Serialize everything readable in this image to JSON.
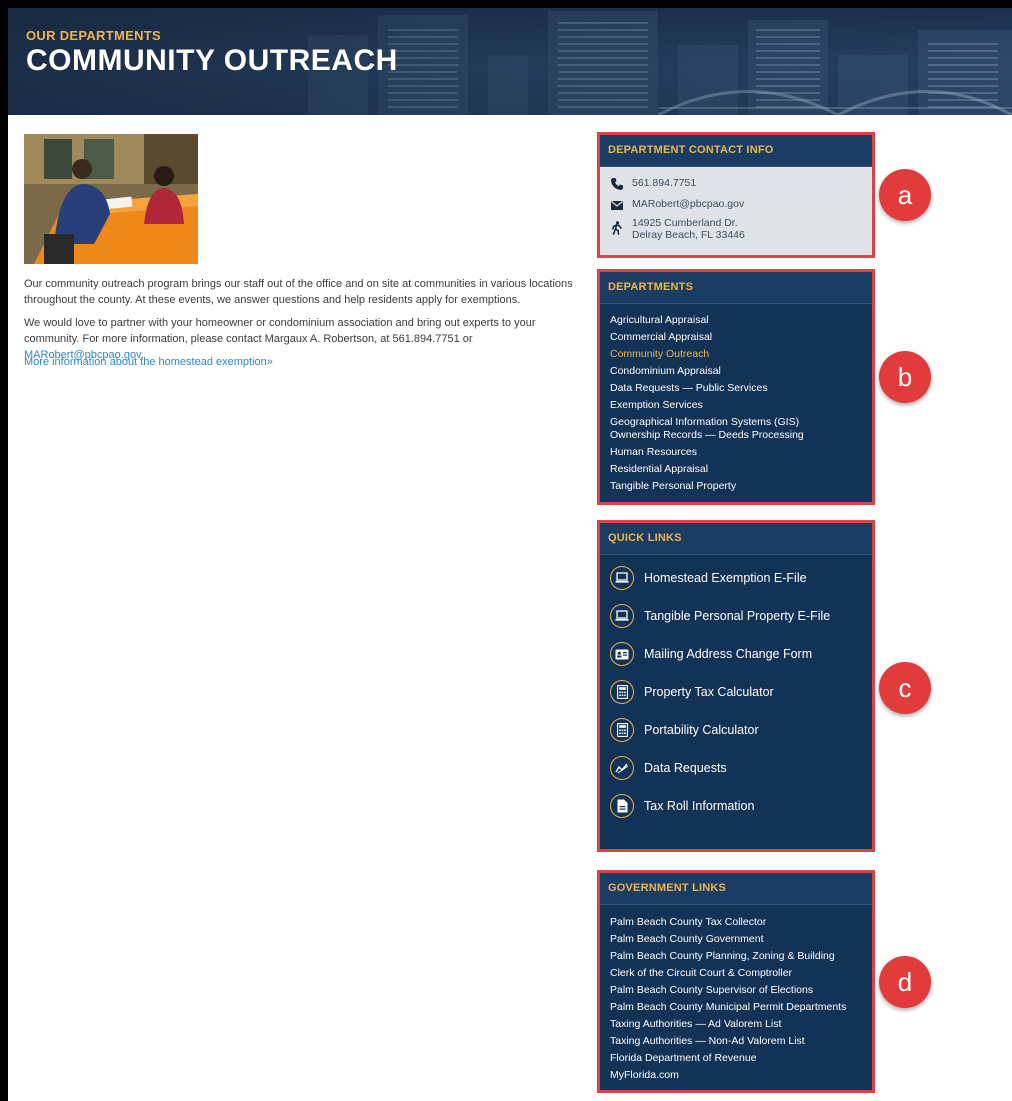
{
  "banner": {
    "eyebrow": "OUR DEPARTMENTS",
    "title": "COMMUNITY OUTREACH"
  },
  "content": {
    "photo_icon": "photo-community-outreach",
    "paragraph1": "Our community outreach program brings our staff out of the office and on site at communities in various locations throughout the county. At these events, we answer questions and help residents apply for exemptions.",
    "paragraph2_pre": "We would love to partner with your homeowner or condominium association and bring out experts to your community. For more information, please contact Margaux A. Robertson, at 561.894.7751 or ",
    "paragraph2_email": "MARobert@pbcpao.gov",
    "paragraph2_post": ".",
    "homestead_link": "More information about the homestead exemption»"
  },
  "contact": {
    "heading": "DEPARTMENT CONTACT INFO",
    "phone": "561.894.7751",
    "email": "MARobert@pbcpao.gov",
    "address_line1": "14925 Cumberland Dr.",
    "address_line2": "Delray Beach, FL 33446"
  },
  "departments": {
    "heading": "DEPARTMENTS",
    "items": [
      "Agricultural Appraisal",
      "Commercial Appraisal",
      "Community Outreach",
      "Condominium Appraisal",
      "Data Requests — Public Services",
      "Exemption Services",
      "Geographical Information Systems (GIS)",
      "Ownership Records — Deeds Processing",
      "Human Resources",
      "Residential Appraisal",
      "Tangible Personal Property"
    ]
  },
  "quick_links": {
    "heading": "QUICK LINKS",
    "items": [
      {
        "label": "Homestead Exemption E-File",
        "icon": "laptop-icon"
      },
      {
        "label": "Tangible Personal Property E-File",
        "icon": "laptop-icon"
      },
      {
        "label": "Mailing Address Change Form",
        "icon": "id-card-icon"
      },
      {
        "label": "Property Tax Calculator",
        "icon": "calculator-icon"
      },
      {
        "label": "Portability Calculator",
        "icon": "calculator-icon"
      },
      {
        "label": "Data Requests",
        "icon": "chart-icon"
      },
      {
        "label": "Tax Roll Information",
        "icon": "document-icon"
      }
    ]
  },
  "government_links": {
    "heading": "GOVERNMENT LINKS",
    "items": [
      "Palm Beach County Tax Collector",
      "Palm Beach County Government",
      "Palm Beach County Planning, Zoning & Building",
      "Clerk of the Circuit Court & Comptroller",
      "Palm Beach County Supervisor of Elections",
      "Palm Beach County Municipal Permit Departments",
      "Taxing Authorities — Ad Valorem List",
      "Taxing Authorities — Non-Ad Valorem List",
      "Florida Department of Revenue",
      "MyFlorida.com"
    ]
  },
  "markers": {
    "a": "a",
    "b": "b",
    "c": "c",
    "d": "d"
  },
  "colors": {
    "accent_gold": "#f0b44c",
    "navy": "#123256",
    "link_blue": "#2f86c6",
    "marker_red": "#e23b3b"
  }
}
